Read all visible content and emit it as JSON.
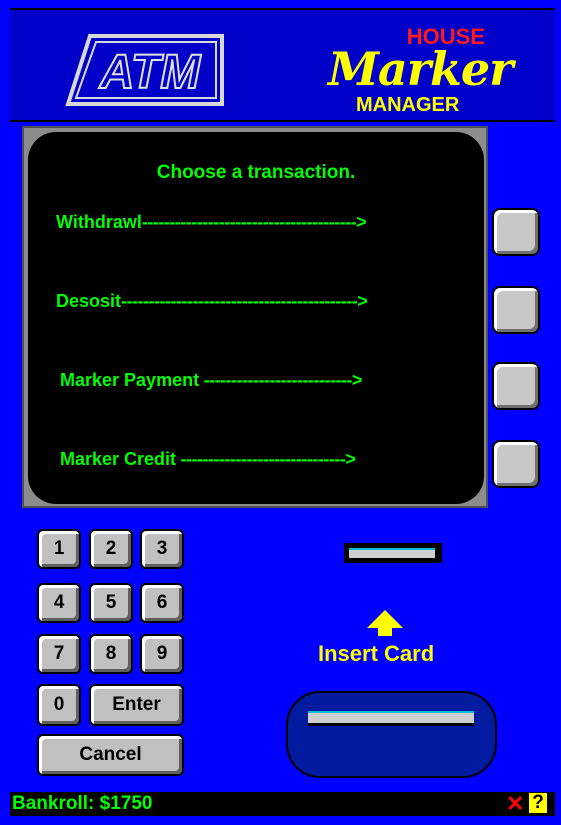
{
  "header": {
    "logo_text": "ATM",
    "brand_house": "HOUSE",
    "brand_marker": "Marker",
    "brand_manager": "MANAGER"
  },
  "screen": {
    "prompt": "Choose a transaction.",
    "options": [
      {
        "label": "Withdrawl",
        "dashes": "--------------------------------------->"
      },
      {
        "label": "Desosit",
        "dashes": "------------------------------------------->"
      },
      {
        "label": "Marker Payment",
        "dashes": " --------------------------->"
      },
      {
        "label": "Marker Credit",
        "dashes": " ------------------------------>"
      }
    ]
  },
  "keypad": {
    "keys": [
      "1",
      "2",
      "3",
      "4",
      "5",
      "6",
      "7",
      "8",
      "9",
      "0"
    ],
    "enter": "Enter",
    "cancel": "Cancel"
  },
  "card": {
    "insert_label": "Insert Card"
  },
  "status": {
    "bankroll": "Bankroll: $1750",
    "close_glyph": "✕",
    "help_glyph": "?"
  },
  "colors": {
    "background": "#0000ff",
    "screen_text": "#00ff00",
    "accent": "#ffff00"
  }
}
